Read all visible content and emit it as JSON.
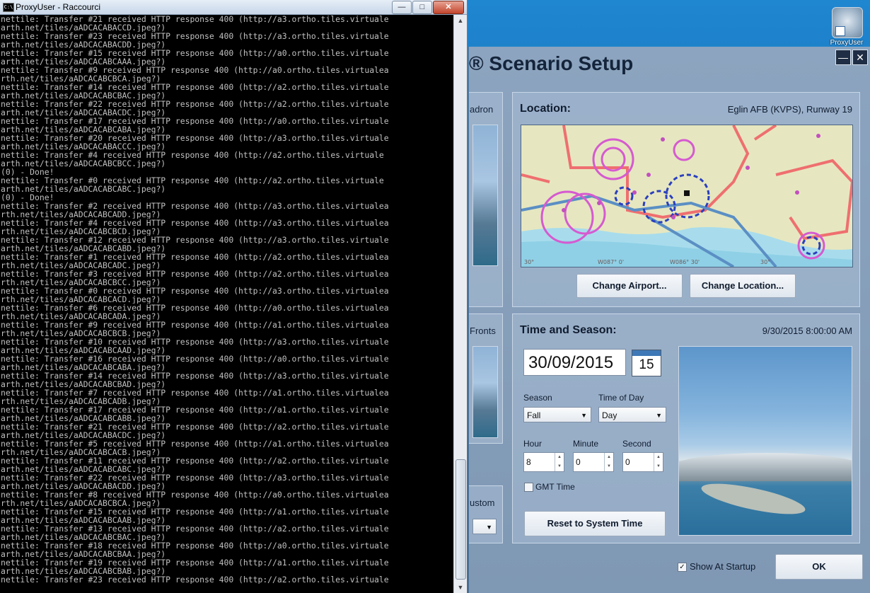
{
  "console": {
    "title": "ProxyUser - Raccourci",
    "icon_text": "C:\\",
    "controls": {
      "minimize": "—",
      "maximize": "□",
      "close": "✕"
    },
    "lines": [
      "nettile: Transfer #21 received HTTP response 400 (http://a3.ortho.tiles.virtuale",
      "arth.net/tiles/aADCACABACCD.jpeg?)",
      "nettile: Transfer #23 received HTTP response 400 (http://a3.ortho.tiles.virtuale",
      "arth.net/tiles/aADCACABACDD.jpeg?)",
      "nettile: Transfer #15 received HTTP response 400 (http://a0.ortho.tiles.virtuale",
      "arth.net/tiles/aADCACABCAAA.jpeg?)",
      "nettile: Transfer #9 received HTTP response 400 (http://a0.ortho.tiles.virtualea",
      "rth.net/tiles/aADCACABCBCA.jpeg?)",
      "nettile: Transfer #14 received HTTP response 400 (http://a2.ortho.tiles.virtuale",
      "arth.net/tiles/aADCACABCBAC.jpeg?)",
      "nettile: Transfer #22 received HTTP response 400 (http://a2.ortho.tiles.virtuale",
      "arth.net/tiles/aADCACABACDC.jpeg?)",
      "nettile: Transfer #17 received HTTP response 400 (http://a0.ortho.tiles.virtuale",
      "arth.net/tiles/aADCACABCABA.jpeg?)",
      "nettile: Transfer #20 received HTTP response 400 (http://a3.ortho.tiles.virtuale",
      "arth.net/tiles/aADCACABACCC.jpeg?)",
      "nettile: Transfer #4 received HTTP response 400 (http://a2.ortho.tiles.virtuale",
      "arth.net/tiles/aADCACABCBCC.jpeg?)",
      "(0) - Done!",
      "nettile: Transfer #0 received HTTP response 400 (http://a2.ortho.tiles.virtuale",
      "arth.net/tiles/aADCACABCABC.jpeg?)",
      "(0) - Done!",
      "nettile: Transfer #2 received HTTP response 400 (http://a3.ortho.tiles.virtualea",
      "rth.net/tiles/aADCACABCADD.jpeg?)",
      "nettile: Transfer #4 received HTTP response 400 (http://a3.ortho.tiles.virtualea",
      "rth.net/tiles/aADCACABCBCD.jpeg?)",
      "nettile: Transfer #12 received HTTP response 400 (http://a3.ortho.tiles.virtuale",
      "arth.net/tiles/aADCACABCABD.jpeg?)",
      "nettile: Transfer #1 received HTTP response 400 (http://a2.ortho.tiles.virtualea",
      "rth.net/tiles/aADCACABCADC.jpeg?)",
      "nettile: Transfer #3 received HTTP response 400 (http://a2.ortho.tiles.virtualea",
      "rth.net/tiles/aADCACABCBCC.jpeg?)",
      "nettile: Transfer #0 received HTTP response 400 (http://a3.ortho.tiles.virtualea",
      "rth.net/tiles/aADCACABCACD.jpeg?)",
      "nettile: Transfer #6 received HTTP response 400 (http://a0.ortho.tiles.virtualea",
      "rth.net/tiles/aADCACABCADA.jpeg?)",
      "nettile: Transfer #9 received HTTP response 400 (http://a1.ortho.tiles.virtualea",
      "rth.net/tiles/aADCACABCBCB.jpeg?)",
      "nettile: Transfer #10 received HTTP response 400 (http://a3.ortho.tiles.virtuale",
      "arth.net/tiles/aADCACABCAAD.jpeg?)",
      "nettile: Transfer #16 received HTTP response 400 (http://a0.ortho.tiles.virtuale",
      "arth.net/tiles/aADCACABCABA.jpeg?)",
      "nettile: Transfer #14 received HTTP response 400 (http://a3.ortho.tiles.virtuale",
      "arth.net/tiles/aADCACABCBAD.jpeg?)",
      "nettile: Transfer #7 received HTTP response 400 (http://a1.ortho.tiles.virtualea",
      "rth.net/tiles/aADCACABCADB.jpeg?)",
      "nettile: Transfer #17 received HTTP response 400 (http://a1.ortho.tiles.virtuale",
      "arth.net/tiles/aADCACABCABB.jpeg?)",
      "nettile: Transfer #21 received HTTP response 400 (http://a2.ortho.tiles.virtuale",
      "arth.net/tiles/aADCACABACDC.jpeg?)",
      "nettile: Transfer #5 received HTTP response 400 (http://a1.ortho.tiles.virtualea",
      "rth.net/tiles/aADCACABCACB.jpeg?)",
      "nettile: Transfer #11 received HTTP response 400 (http://a2.ortho.tiles.virtuale",
      "arth.net/tiles/aADCACABCABC.jpeg?)",
      "nettile: Transfer #22 received HTTP response 400 (http://a3.ortho.tiles.virtuale",
      "arth.net/tiles/aADCACABACDD.jpeg?)",
      "nettile: Transfer #8 received HTTP response 400 (http://a0.ortho.tiles.virtualea",
      "rth.net/tiles/aADCACABCBCA.jpeg?)",
      "nettile: Transfer #15 received HTTP response 400 (http://a1.ortho.tiles.virtuale",
      "arth.net/tiles/aADCACABCAAB.jpeg?)",
      "nettile: Transfer #13 received HTTP response 400 (http://a2.ortho.tiles.virtuale",
      "arth.net/tiles/aADCACABCBAC.jpeg?)",
      "nettile: Transfer #18 received HTTP response 400 (http://a0.ortho.tiles.virtuale",
      "arth.net/tiles/aADCACABCBAA.jpeg?)",
      "nettile: Transfer #19 received HTTP response 400 (http://a1.ortho.tiles.virtuale",
      "arth.net/tiles/aADCACABCBAB.jpeg?)",
      "nettile: Transfer #23 received HTTP response 400 (http://a2.ortho.tiles.virtuale"
    ]
  },
  "desktop": {
    "shortcut_label": "ProxyUser"
  },
  "scenario": {
    "title": "® Scenario Setup",
    "controls": {
      "minimize": "—",
      "close": "✕"
    },
    "left_fragments": {
      "squadron": "adron",
      "fronts": "Fronts",
      "custom": "ustom"
    },
    "location": {
      "heading": "Location:",
      "value": "Eglin AFB (KVPS), Runway 19",
      "map_labels": {
        "lon1": "W087° 0'",
        "lon2": "W086° 30'",
        "lat1": "30°",
        "lat2": "30°"
      },
      "change_airport": "Change Airport...",
      "change_location": "Change Location..."
    },
    "time": {
      "heading": "Time and Season:",
      "value": "9/30/2015 8:00:00 AM",
      "date": "30/09/2015",
      "calendar_day": "15",
      "season_label": "Season",
      "season_value": "Fall",
      "timeofday_label": "Time of Day",
      "timeofday_value": "Day",
      "hour_label": "Hour",
      "hour_value": "8",
      "minute_label": "Minute",
      "minute_value": "0",
      "second_label": "Second",
      "second_value": "0",
      "gmt_label": "GMT Time",
      "reset_label": "Reset to System Time"
    },
    "show_at_startup_label": "Show At Startup",
    "ok_label": "OK"
  }
}
